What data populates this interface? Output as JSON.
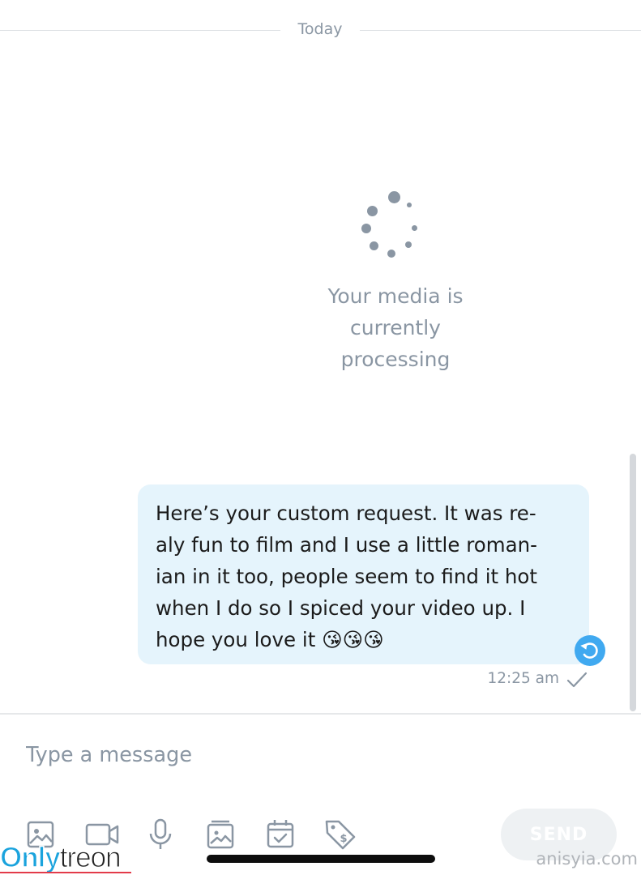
{
  "chat": {
    "date_divider": "Today",
    "media": {
      "status_text": "Your media is\ncurrently\nprocessing"
    },
    "message": {
      "text": "Here’s your custom request. It was re-\naly fun to film and I use a little roman-\nian in it too, people seem to find it hot\nwhen I do so I spiced your video up. I\nhope you love it 😘😘😘",
      "time": "12:25 am",
      "status_icon": "check-icon",
      "action_icon": "undo-icon"
    }
  },
  "composer": {
    "placeholder": "Type a message",
    "value": "",
    "send_label": "SEND",
    "tools": [
      "image-icon",
      "video-icon",
      "microphone-icon",
      "gallery-icon",
      "schedule-icon",
      "price-tag-icon"
    ]
  },
  "watermark": {
    "left_brand_part1": "Only",
    "left_brand_part2": "treon",
    "right_text": "anisyia.com"
  },
  "colors": {
    "bubble_bg": "#e5f4fc",
    "accent": "#40a9f0",
    "muted_text": "#8a96a3",
    "brand_blue": "#1aa3dd"
  }
}
